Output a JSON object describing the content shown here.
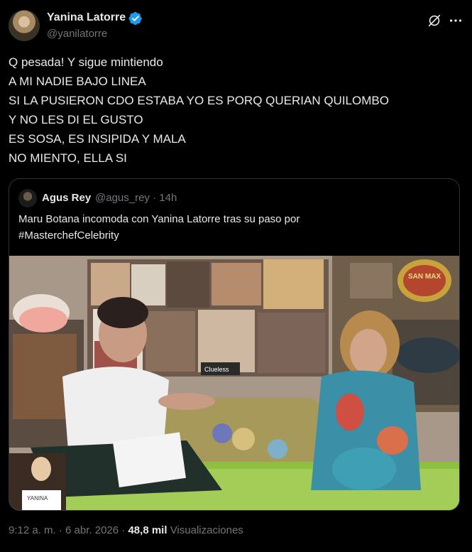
{
  "author": {
    "name": "Yanina Latorre",
    "handle": "@yanilatorre",
    "verified": true,
    "badge_color": "#1d9bf0"
  },
  "actions": {
    "grok_icon": "grok-icon",
    "more_icon": "more-icon"
  },
  "tweet": {
    "lines": [
      "Q pesada! Y sigue mintiendo",
      "A MI NADIE BAJO LINEA",
      "SI LA PUSIERON CDO ESTABA YO ES PORQ QUERIAN QUILOMBO",
      "Y NO LES DI EL GUSTO",
      "ES SOSA, ES INSIPIDA Y MALA",
      "NO MIENTO, ELLA SI"
    ]
  },
  "quoted": {
    "name": "Agus Rey",
    "handle": "@agus_rey",
    "separator": "·",
    "time": "14h",
    "text_lines": [
      "Maru Botana incomoda con Yanina Latorre tras su paso por",
      "#MasterchefCelebrity"
    ],
    "media": {
      "inset_label": "YANINA",
      "poster_label": "Clueless",
      "sign_label": "SAN MAX"
    }
  },
  "meta": {
    "time": "9:12 a. m.",
    "separator": "·",
    "date": "6 abr. 2026",
    "views_count": "48,8 mil",
    "views_label": "Visualizaciones"
  },
  "colors": {
    "background": "#000000",
    "text": "#e7e9ea",
    "muted": "#71767b",
    "border": "#2f3336",
    "accent": "#1d9bf0"
  }
}
